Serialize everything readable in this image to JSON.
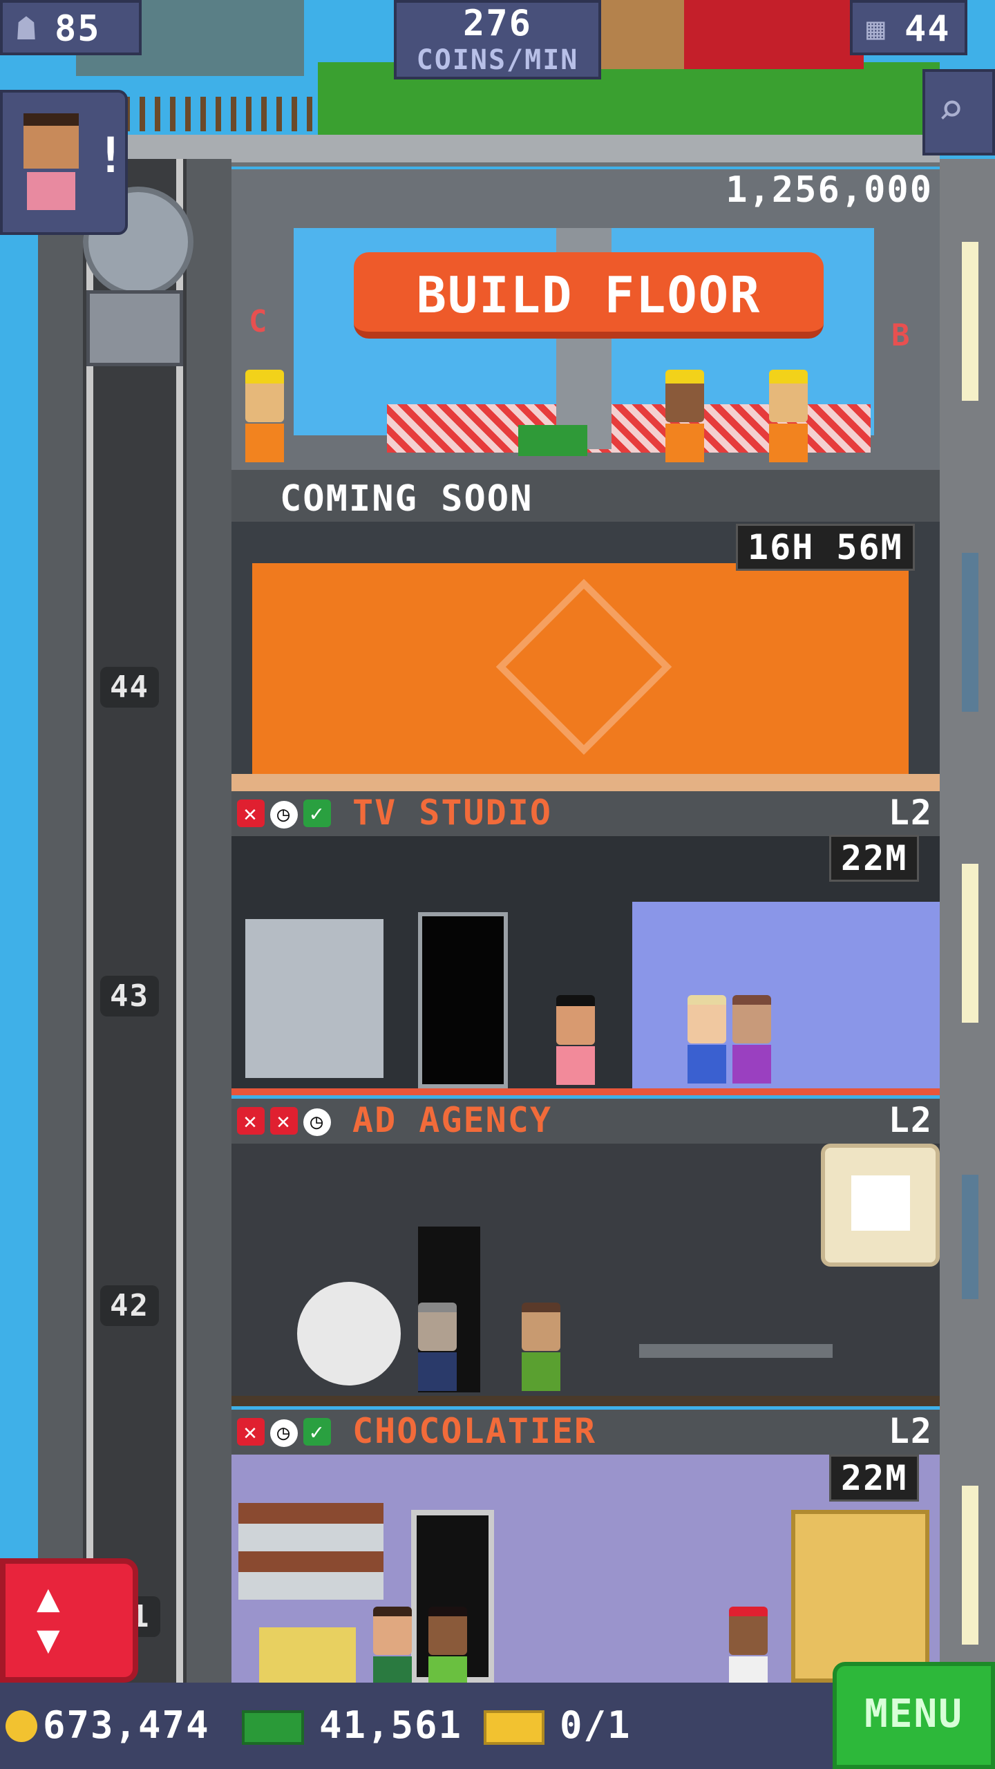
{
  "hud": {
    "population": "85",
    "income_value": "276",
    "income_unit": "COINS/MIN",
    "floors": "44"
  },
  "build": {
    "cost": "1,256,000",
    "button_label": "BUILD FLOOR",
    "left_letter": "C",
    "right_letter": "B"
  },
  "coming_soon": {
    "label": "COMING SOON",
    "timer": "16H 56M"
  },
  "floors": [
    {
      "name": "TV STUDIO",
      "level": "L2",
      "timer": "22M",
      "elevator_number": "44"
    },
    {
      "name": "AD AGENCY",
      "level": "L2",
      "timer": "",
      "elevator_number": "43"
    },
    {
      "name": "CHOCOLATIER",
      "level": "L2",
      "timer": "22M",
      "elevator_number": "42"
    }
  ],
  "elevator_bottom_number": "1",
  "bottom": {
    "coins": "673,474",
    "bux": "41,561",
    "tickets": "0/1",
    "menu_label": "MENU"
  },
  "colors": {
    "sky": "#3fb0e8",
    "build_button": "#ee5a2a",
    "floor_title": "#f26b3a",
    "menu_green": "#2db83a",
    "elevator_button": "#e8243c"
  }
}
